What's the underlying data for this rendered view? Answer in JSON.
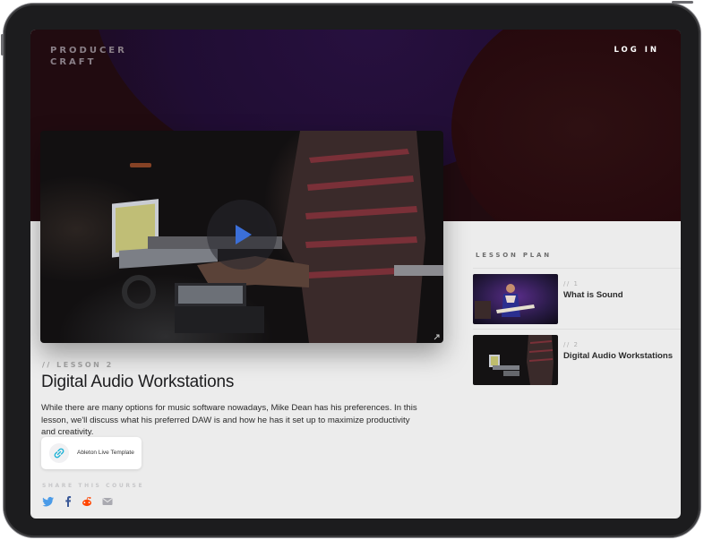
{
  "header": {
    "logo_line1": "PRODUCER",
    "logo_line2": "CRAFT",
    "login_label": "LOG IN"
  },
  "video": {
    "play_icon": "play-icon",
    "expand_icon": "expand-icon"
  },
  "lesson": {
    "label": "// LESSON 2",
    "title": "Digital Audio Workstations",
    "description": "While there are many options for music software nowadays, Mike Dean has his preferences. In this lesson, we'll discuss what his preferred DAW is and how he has it set up to maximize productivity and creativity."
  },
  "resource": {
    "label": "Ableton Live Template",
    "icon": "link-icon"
  },
  "share": {
    "label": "SHARE THIS COURSE",
    "icons": [
      "twitter-icon",
      "facebook-icon",
      "reddit-icon",
      "mail-icon"
    ]
  },
  "lesson_plan": {
    "label": "LESSON PLAN",
    "items": [
      {
        "number": "// 1",
        "title": "What is Sound"
      },
      {
        "number": "// 2",
        "title": "Digital Audio Workstations"
      }
    ]
  },
  "colors": {
    "hero_bg": "#210b10",
    "accent_purple": "#27103f",
    "play_blue": "#3b6fd8",
    "link_cyan": "#1fb3d6",
    "twitter": "#4a9be8",
    "facebook": "#3b5998",
    "reddit": "#ff4500",
    "mail": "#a9a9b0"
  }
}
